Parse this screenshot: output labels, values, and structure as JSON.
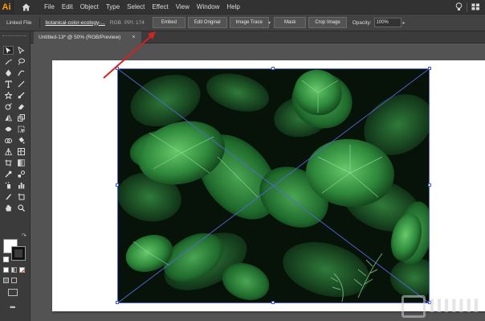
{
  "app": {
    "logo": "Ai"
  },
  "menu": {
    "items": [
      "File",
      "Edit",
      "Object",
      "Type",
      "Select",
      "Effect",
      "View",
      "Window",
      "Help"
    ]
  },
  "controlbar": {
    "linked_file_label": "Linked File",
    "file_name": "botanical-color-ecology-...",
    "color_mode": "RGB",
    "ppi": "PPI: 174",
    "embed_label": "Embed",
    "edit_original_label": "Edit Original",
    "image_trace_label": "Image Trace",
    "mask_label": "Mask",
    "crop_image_label": "Crop Image",
    "opacity_label": "Opacity:",
    "opacity_value": "100%"
  },
  "document": {
    "tab_title": "Untitled-13* @ 50% (RGB/Preview)",
    "close_glyph": "×"
  },
  "colors": {
    "accent": "#ff9a00",
    "selection": "#3a5bd6",
    "annotation_arrow": "#e02020"
  },
  "icons": {
    "home": "home-icon",
    "search": "lightbulb-icon",
    "workspace": "workspace-switcher-icon"
  }
}
